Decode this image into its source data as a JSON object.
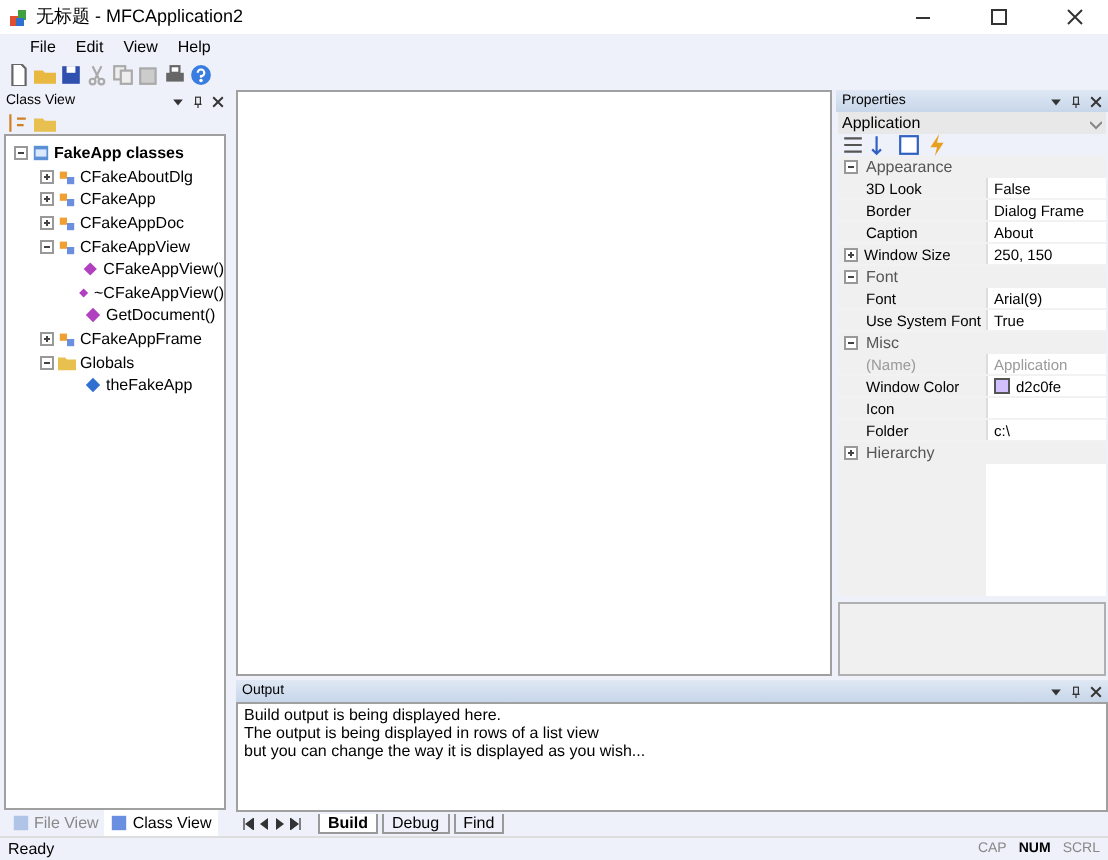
{
  "window": {
    "title": "无标题 - MFCApplication2"
  },
  "menu": [
    "File",
    "Edit",
    "View",
    "Help"
  ],
  "class_view": {
    "title": "Class View",
    "tree": [
      {
        "label": "FakeApp classes",
        "kind": "root",
        "expanded": true,
        "children": [
          {
            "label": "CFakeAboutDlg",
            "kind": "class",
            "expanded": false
          },
          {
            "label": "CFakeApp",
            "kind": "class",
            "expanded": false
          },
          {
            "label": "CFakeAppDoc",
            "kind": "class",
            "expanded": false
          },
          {
            "label": "CFakeAppView",
            "kind": "class",
            "expanded": true,
            "children": [
              {
                "label": "CFakeAppView()",
                "kind": "method"
              },
              {
                "label": "~CFakeAppView()",
                "kind": "method"
              },
              {
                "label": "GetDocument()",
                "kind": "method"
              }
            ]
          },
          {
            "label": "CFakeAppFrame",
            "kind": "class",
            "expanded": false
          },
          {
            "label": "Globals",
            "kind": "folder",
            "expanded": true,
            "children": [
              {
                "label": "theFakeApp",
                "kind": "variable"
              }
            ]
          }
        ]
      }
    ],
    "tabs": [
      {
        "label": "File View",
        "selected": false
      },
      {
        "label": "Class View",
        "selected": true
      }
    ]
  },
  "properties": {
    "title": "Properties",
    "object": "Application",
    "groups": [
      {
        "name": "Appearance",
        "expanded": true,
        "rows": [
          {
            "name": "3D Look",
            "value": "False",
            "disabled": false
          },
          {
            "name": "Border",
            "value": "Dialog Frame",
            "disabled": false
          },
          {
            "name": "Caption",
            "value": "About",
            "disabled": false
          },
          {
            "name": "Window Size",
            "value": "250, 150",
            "disabled": false,
            "expandable": true
          }
        ]
      },
      {
        "name": "Font",
        "expanded": true,
        "rows": [
          {
            "name": "Font",
            "value": "Arial(9)",
            "disabled": false
          },
          {
            "name": "Use System Font",
            "value": "True",
            "disabled": false
          }
        ]
      },
      {
        "name": "Misc",
        "expanded": true,
        "rows": [
          {
            "name": "(Name)",
            "value": "Application",
            "disabled": true
          },
          {
            "name": "Window Color",
            "value": "d2c0fe",
            "disabled": false,
            "color": "#d2c0fe"
          },
          {
            "name": "Icon",
            "disabled": false
          },
          {
            "name": "Folder",
            "value": "c:\\",
            "disabled": false
          }
        ]
      },
      {
        "name": "Hierarchy",
        "expanded": false
      }
    ]
  },
  "output": {
    "title": "Output",
    "lines": [
      "Build output is being displayed here.",
      "The output is being displayed in rows of a list view",
      "but you can change the way it is displayed as you wish..."
    ],
    "tabs": [
      {
        "label": "Build",
        "selected": true
      },
      {
        "label": "Debug",
        "selected": false
      },
      {
        "label": "Find",
        "selected": false
      }
    ]
  },
  "status_bar": {
    "text": "Ready",
    "indicators": [
      {
        "label": "CAP",
        "on": false
      },
      {
        "label": "NUM",
        "on": true
      },
      {
        "label": "SCRL",
        "on": false
      }
    ]
  }
}
